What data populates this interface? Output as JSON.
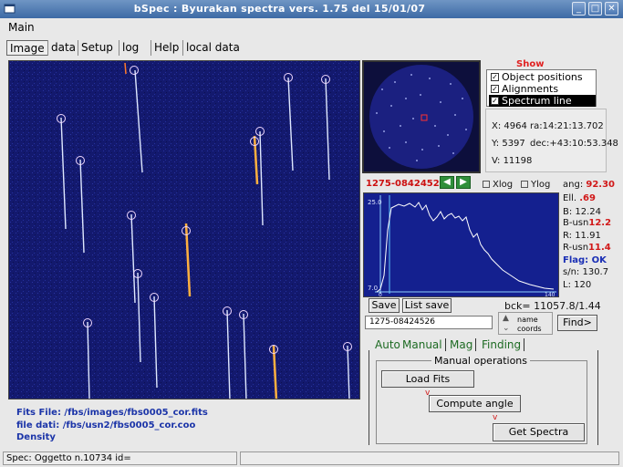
{
  "window": {
    "title": "bSpec : Byurakan spectra vers. 1.75        del  15/01/07"
  },
  "menubar": {
    "main": "Main"
  },
  "tabs": [
    {
      "label": "Image"
    },
    {
      "label": "data"
    },
    {
      "label": "Setup"
    },
    {
      "label": "log"
    },
    {
      "label": "Help"
    },
    {
      "label": "local data"
    }
  ],
  "file_info": {
    "fits_file": "Fits File: /fbs/images/fbs0005_cor.fits",
    "data_file": "file dati: /fbs/usn2/fbs0005_cor.coo",
    "density": "Density"
  },
  "show_panel": {
    "title": "Show",
    "options": [
      {
        "label": "Object positions",
        "checked": true
      },
      {
        "label": "Alignments",
        "checked": true
      },
      {
        "label": "Spectrum line",
        "checked": true
      }
    ]
  },
  "coords": {
    "x": "X: 4964",
    "ra": "ra:14:21:13.702",
    "y": "Y: 5397",
    "dec": "dec:+43:10:53.348",
    "v": "V: 11198"
  },
  "spectrum": {
    "id": "1275-08424526",
    "prev_icon": "arrow-left-icon",
    "next_icon": "arrow-right-icon"
  },
  "log_options": {
    "xlog": "Xlog",
    "ylog": "Ylog"
  },
  "graph": {
    "y_top": "25.0",
    "y_bottom": "7.0",
    "x_left": "0",
    "x_right": "140"
  },
  "stats": {
    "ang_label": "ang:",
    "ang_value": "92.30",
    "ell_label": "Ell.",
    "ell_value": ".69",
    "b": "B: 12.24",
    "busn_label": "B-usn",
    "busn_value": "12.2",
    "r": "R: 11.91",
    "rusn_label": "R-usn",
    "rusn_value": "11.4",
    "flag": "Flag: OK",
    "sn": "s/n: 130.7",
    "l": "L: 120"
  },
  "buttons": {
    "save": "Save",
    "list_save": "List save",
    "find": "Find>",
    "load_fits": "Load Fits",
    "compute_angle": "Compute angle",
    "get_spectra": "Get Spectra"
  },
  "bck": "bck= 11057.8/1.44",
  "id_input": "1275-08424526",
  "sort_toggle": {
    "name": "name",
    "coords": "coords"
  },
  "lower_tabs": [
    {
      "label": "Auto"
    },
    {
      "label": "Manual"
    },
    {
      "label": "Mag"
    },
    {
      "label": "Finding"
    }
  ],
  "manual_ops": {
    "legend": "Manual operations",
    "mark": "v"
  },
  "status": {
    "text": "Spec: Oggetto n.10734 id="
  },
  "colors": {
    "image_bg": "#13196e",
    "graph_bg": "#14208f",
    "title_bar": "#3d6aa5",
    "accent_red": "#d11818"
  }
}
